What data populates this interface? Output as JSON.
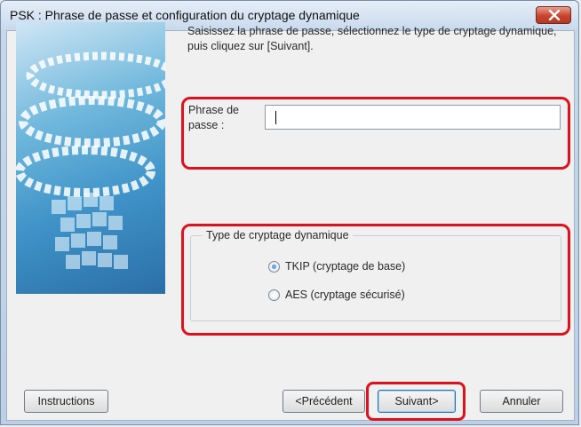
{
  "window": {
    "title": "PSK : Phrase de passe et configuration du cryptage dynamique",
    "close_icon": "close-icon",
    "close_color": "#c8432d"
  },
  "instructions_text": "Saisissez la phrase de passe, sélectionnez le type de cryptage dynamique, puis cliquez sur [Suivant].",
  "passphrase": {
    "label_line1": "Phrase de",
    "label_line2": "passe :",
    "value": ""
  },
  "encryption_group": {
    "legend": "Type de cryptage dynamique",
    "options": [
      {
        "label": "TKIP (cryptage de base)",
        "selected": true
      },
      {
        "label": "AES (cryptage sécurisé)",
        "selected": false
      }
    ]
  },
  "buttons": {
    "instructions": "Instructions",
    "previous": "<Précédent",
    "next": "Suivant>",
    "cancel": "Annuler"
  },
  "highlight_color": "#e0101c"
}
